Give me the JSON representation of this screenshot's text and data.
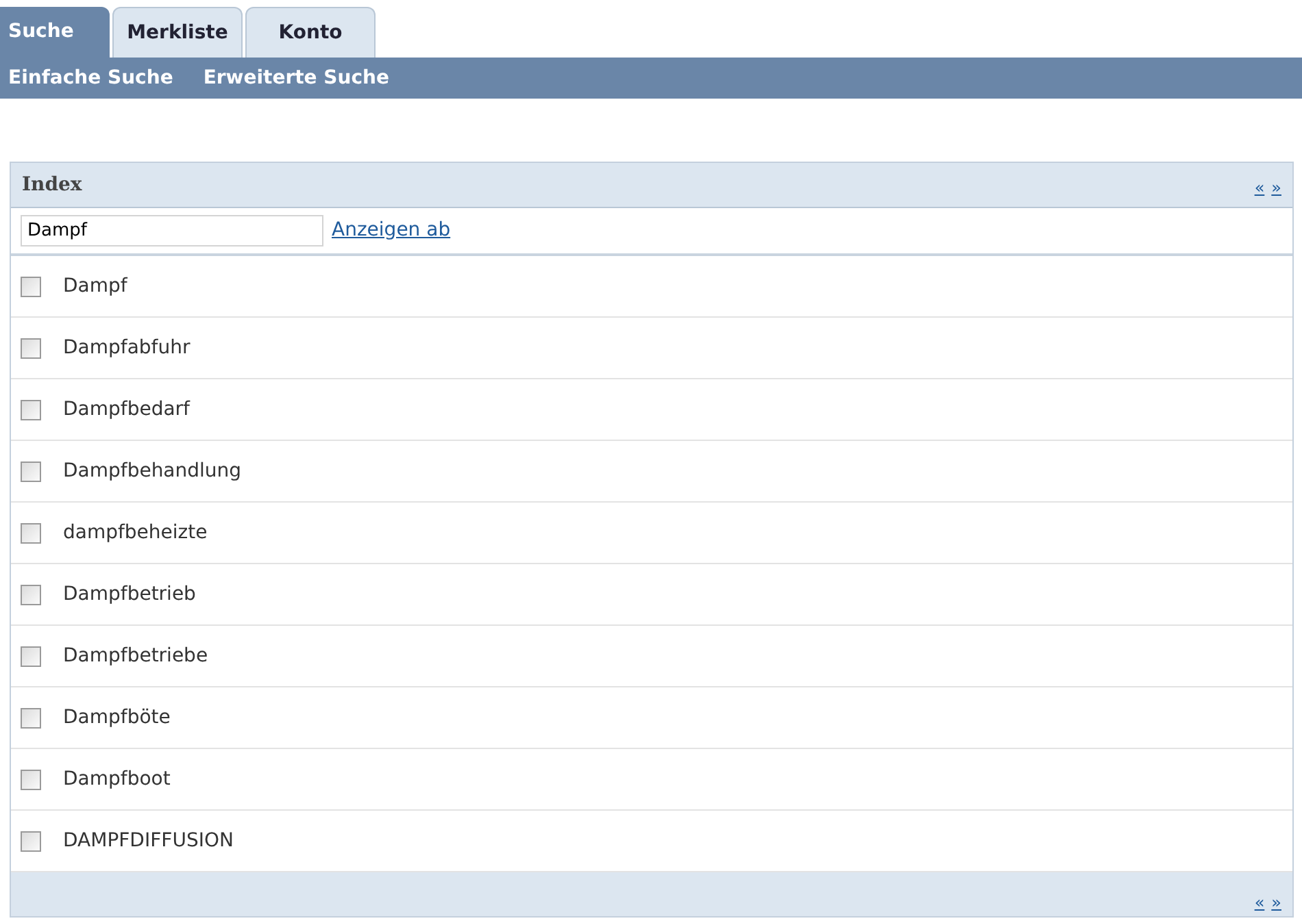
{
  "tabs": [
    {
      "label": "Suche",
      "selected": true
    },
    {
      "label": "Merkliste",
      "selected": false
    },
    {
      "label": "Konto",
      "selected": false
    }
  ],
  "subnav": [
    "Einfache Suche",
    "Erweiterte Suche"
  ],
  "panel": {
    "title": "Index",
    "pager_top": [
      "«",
      "»"
    ],
    "search": {
      "value": "Dampf"
    },
    "search_link": "Anzeigen ab",
    "items": [
      {
        "label": "Dampf",
        "checked": false
      },
      {
        "label": "Dampfabfuhr",
        "checked": false
      },
      {
        "label": "Dampfbedarf",
        "checked": false
      },
      {
        "label": "Dampfbehandlung",
        "checked": false
      },
      {
        "label": "dampfbeheizte",
        "checked": false
      },
      {
        "label": "Dampfbetrieb",
        "checked": false
      },
      {
        "label": "Dampfbetriebe",
        "checked": false
      },
      {
        "label": "Dampfböte",
        "checked": false
      },
      {
        "label": "Dampfboot",
        "checked": false
      },
      {
        "label": "DAMPFDIFFUSION",
        "checked": false
      }
    ],
    "pager_bottom": [
      "«",
      "»"
    ]
  }
}
